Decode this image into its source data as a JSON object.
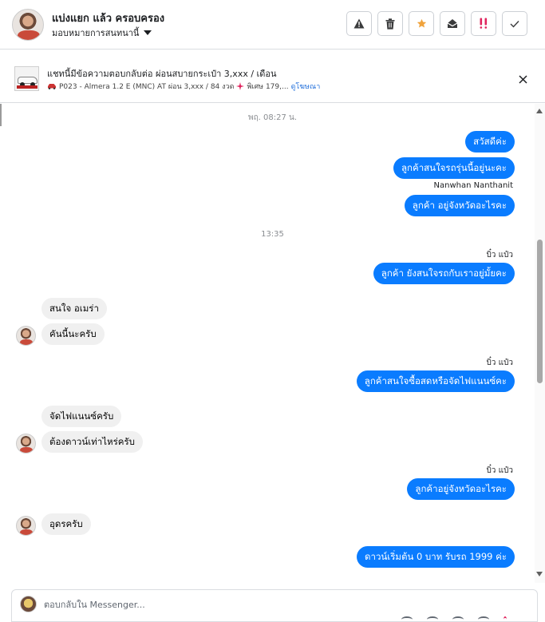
{
  "header": {
    "contact_name": "แบ่งแยก แล้ว ครอบครอง",
    "assign_label": "มอบหมายการสนทนานี้",
    "action_icons": [
      "warning-icon",
      "trash-icon",
      "star-icon",
      "inbox-icon",
      "urgent-icon",
      "check-icon"
    ],
    "star_color": "#f0a33c",
    "urgent_color": "#e0245e"
  },
  "ad": {
    "title": "แชทนี้มีข้อความตอบกลับต่อ ผ่อนสบายกระเป๋า 3,xxx / เดือน",
    "subtitle": "P023 - Almera 1.2 E (MNC) AT ผ่อน 3,xxx / 84 งวด",
    "promo": "พิเศษ 179,...",
    "link": "ดูโฆษณา"
  },
  "thread": {
    "timestamp_1": "พฤ. 08:27 น.",
    "timestamp_2": "13:35",
    "msg_1": "สวัสดีค่ะ",
    "msg_2": "ลูกค้าสนใจรถรุ่นนี้อยู่นะคะ",
    "sender_1": "Nanwhan Nanthanit",
    "msg_3": "ลูกค้า อยู่จังหวัดอะไรคะ",
    "sender_2": "บิ๋ว แป๋ว",
    "msg_4": "ลูกค้า ยังสนใจรถกับเราอยู่มั้ยคะ",
    "msg_5": "สนใจ อเมร่า",
    "msg_6": "คันนี้นะครับ",
    "sender_3": "บิ๋ว แป๋ว",
    "msg_7": "ลูกค้าสนใจซื้อสดหรือจัดไฟแนนซ์คะ",
    "msg_8": "จัดไฟแนนซ์ครับ",
    "msg_9": "ต้องดาวน์เท่าไหร่ครับ",
    "sender_4": "บิ๋ว แป๋ว",
    "msg_10": "ลูกค้าอยู่จังหวัดอะไรคะ",
    "msg_11": "อุดรครับ",
    "msg_12": "ดาวน์เริ่มต้น 0 บาท รับรถ 1999 ค่ะ"
  },
  "composer": {
    "placeholder": "ตอบกลับใน Messenger..."
  },
  "colors": {
    "outgoing_bubble": "#0a7cff",
    "incoming_bubble": "#f0f0f0"
  }
}
